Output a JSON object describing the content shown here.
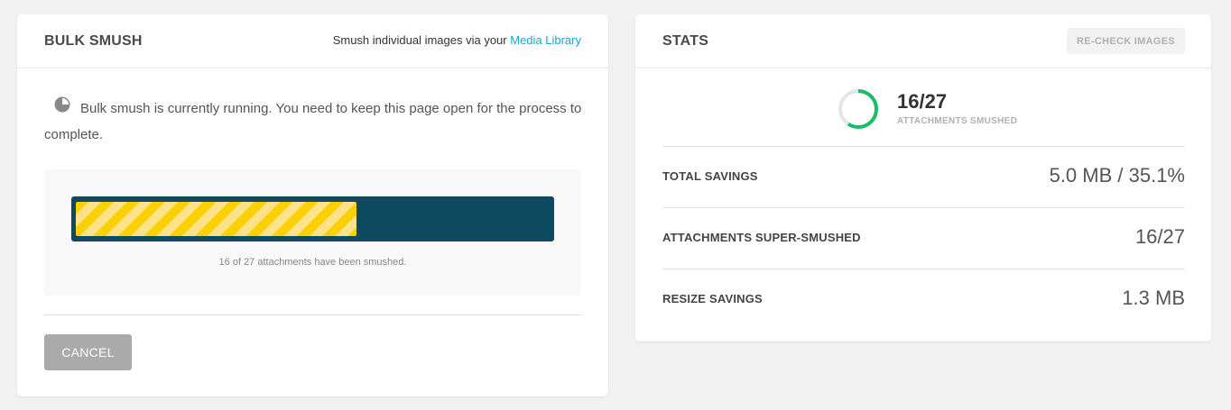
{
  "bulk_smush": {
    "title": "BULK SMUSH",
    "header_hint": "Smush individual images via your ",
    "media_library_link": "Media Library",
    "notice_text": "Bulk smush is currently running. You need to keep this page open for the process to complete.",
    "progress": {
      "fraction": 0.593,
      "caption": "16 of 27 attachments have been smushed."
    },
    "cancel_label": "CANCEL"
  },
  "stats": {
    "title": "STATS",
    "recheck_label": "RE-CHECK IMAGES",
    "count": "16/27",
    "count_label": "ATTACHMENTS SMUSHED",
    "circle_fraction": 0.593,
    "rows": [
      {
        "label": "TOTAL SAVINGS",
        "value": "5.0 MB / 35.1%"
      },
      {
        "label": "ATTACHMENTS SUPER-SMUSHED",
        "value": "16/27"
      },
      {
        "label": "RESIZE SAVINGS",
        "value": "1.3 MB"
      }
    ]
  },
  "colors": {
    "accent_link": "#17a8c9",
    "progress_track": "#0e4a5f",
    "progress_stripe": "#fbd000",
    "circle_done": "#1abc6b",
    "circle_rest": "#e5e5e5"
  },
  "icons": {
    "notice": "loading-spinner-icon"
  }
}
